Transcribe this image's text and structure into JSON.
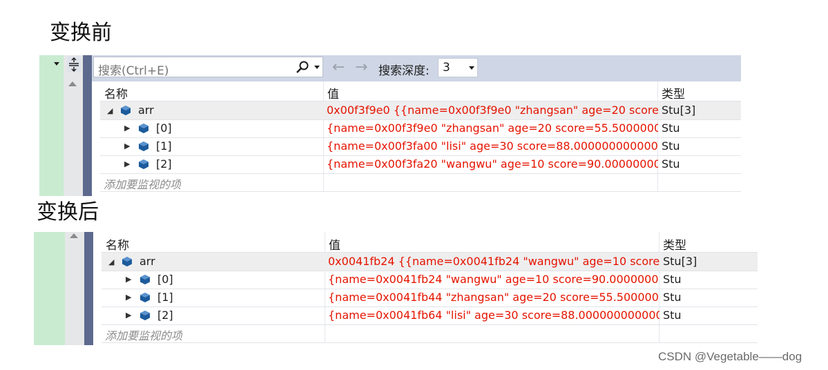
{
  "headings": {
    "before": "变换前",
    "after": "变换后"
  },
  "toolbar": {
    "search_placeholder": "搜索(Ctrl+E)",
    "depth_label": "搜索深度:",
    "depth_value": "3"
  },
  "columns": {
    "name": "名称",
    "value": "值",
    "type": "类型"
  },
  "add_watch": "添加要监视的项",
  "before": {
    "rows": [
      {
        "name": "arr",
        "value": "0x00f3f9e0 {{name=0x00f3f9e0 \"zhangsan\" age=20 score=...",
        "type": "Stu[3]"
      },
      {
        "name": "[0]",
        "value": "{name=0x00f3f9e0 \"zhangsan\" age=20 score=55.5000000...",
        "type": "Stu"
      },
      {
        "name": "[1]",
        "value": "{name=0x00f3fa00 \"lisi\" age=30 score=88.0000000000000...",
        "type": "Stu"
      },
      {
        "name": "[2]",
        "value": "{name=0x00f3fa20 \"wangwu\" age=10 score=90.00000000...",
        "type": "Stu"
      }
    ]
  },
  "after": {
    "rows": [
      {
        "name": "arr",
        "value": "0x0041fb24 {{name=0x0041fb24 \"wangwu\" age=10 score...",
        "type": "Stu[3]"
      },
      {
        "name": "[0]",
        "value": "{name=0x0041fb24 \"wangwu\" age=10 score=90.0000000...",
        "type": "Stu"
      },
      {
        "name": "[1]",
        "value": "{name=0x0041fb44 \"zhangsan\" age=20 score=55.500000...",
        "type": "Stu"
      },
      {
        "name": "[2]",
        "value": "{name=0x0041fb64 \"lisi\" age=30 score=88.000000000000...",
        "type": "Stu"
      }
    ]
  },
  "watermark": "CSDN @Vegetable——dog",
  "colors": {
    "value_red": "#e51400",
    "cube_blue": "#1c5b9c",
    "toolbar_bg": "#cfd6e5",
    "green_margin": "#c9ecd0"
  }
}
